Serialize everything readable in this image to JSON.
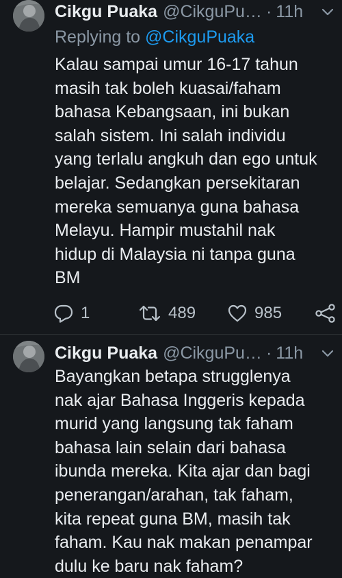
{
  "tweets": [
    {
      "name": "Cikgu Puaka",
      "handle": "@CikguPu…",
      "dot": "·",
      "time": "11h",
      "replying_label": "Replying to",
      "replying_to": "@CikguPuaka",
      "text": "Kalau sampai umur 16-17 tahun\nmasih tak boleh kuasai/faham\nbahasa Kebangsaan, ini bukan\nsalah sistem. Ini salah individu\nyang terlalu angkuh dan ego untuk\nbelajar. Sedangkan persekitaran\nmereka semuanya guna bahasa\nMelayu. Hampir mustahil nak\nhidup di Malaysia ni tanpa guna\nBM",
      "replies": "1",
      "retweets": "489",
      "likes": "985"
    },
    {
      "name": "Cikgu Puaka",
      "handle": "@CikguPu…",
      "dot": "·",
      "time": "11h",
      "text": "Bayangkan betapa strugglenya\nnak ajar Bahasa Inggeris kepada\nmurid yang langsung tak faham\nbahasa lain selain dari bahasa\nibunda mereka. Kita ajar dan bagi\npenerangan/arahan, tak faham,\nkita repeat guna BM, masih tak\nfaham. Kau nak makan penampar\ndulu ke baru nak faham?"
    }
  ],
  "icons": {
    "reply": "reply-icon",
    "retweet": "retweet-icon",
    "like": "heart-icon",
    "share": "share-icon",
    "more": "chevron-down-icon"
  },
  "colors": {
    "background": "#15181c",
    "text": "#e9ecef",
    "secondary": "#8b98a5",
    "link": "#1d9bf0"
  }
}
